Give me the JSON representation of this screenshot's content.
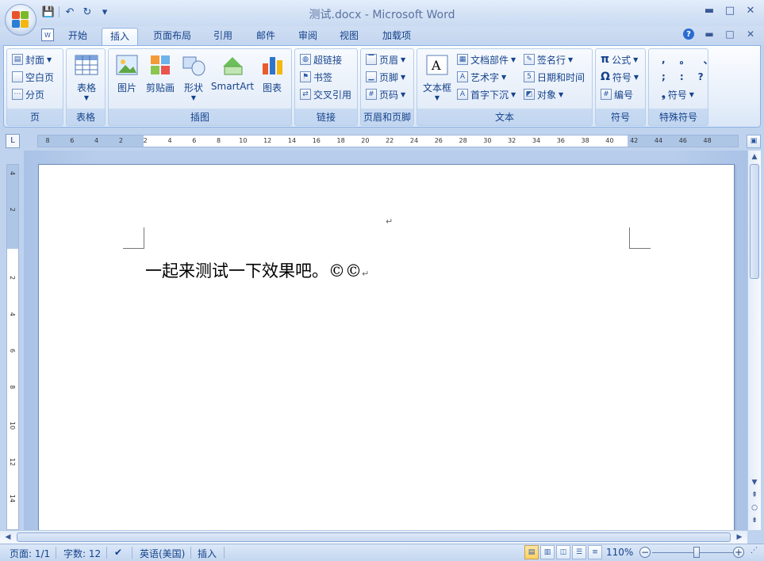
{
  "window": {
    "title": "测试.docx - Microsoft Word",
    "minimize": "▬",
    "maximize": "□",
    "close": "✕"
  },
  "qat": {
    "save": "💾",
    "undo": "↶",
    "redo": "↻",
    "customize": "▾"
  },
  "tabs": [
    {
      "label": "开始"
    },
    {
      "label": "插入"
    },
    {
      "label": "页面布局"
    },
    {
      "label": "引用"
    },
    {
      "label": "邮件"
    },
    {
      "label": "审阅"
    },
    {
      "label": "视图"
    },
    {
      "label": "加载项"
    }
  ],
  "active_tab": "插入",
  "ribbon": {
    "pages": {
      "label": "页",
      "items": [
        "封面",
        "空白页",
        "分页"
      ]
    },
    "tables": {
      "label": "表格",
      "table": "表格"
    },
    "illustrations": {
      "label": "插图",
      "picture": "图片",
      "clipart": "剪贴画",
      "shapes": "形状",
      "smartart": "SmartArt",
      "chart": "图表"
    },
    "links": {
      "label": "链接",
      "items": [
        "超链接",
        "书签",
        "交叉引用"
      ]
    },
    "header_footer": {
      "label": "页眉和页脚",
      "items": [
        "页眉",
        "页脚",
        "页码"
      ]
    },
    "text": {
      "label": "文本",
      "textbox": "文本框",
      "col1": [
        "文档部件",
        "艺术字",
        "首字下沉"
      ],
      "col2": [
        "签名行",
        "日期和时间",
        "对象"
      ]
    },
    "symbols": {
      "label": "符号",
      "items": [
        "公式",
        "符号",
        "编号"
      ],
      "glyphs": [
        "π",
        "Ω",
        "#"
      ]
    },
    "special": {
      "label": "特殊符号",
      "row1": [
        ",",
        "。",
        "、"
      ],
      "row2": [
        ";",
        ":",
        "?"
      ],
      "symbol": "符号",
      "bullet": "❟"
    }
  },
  "ruler": {
    "corner": "L",
    "labels": [
      "8",
      "6",
      "4",
      "2",
      "2",
      "4",
      "6",
      "8",
      "10",
      "12",
      "14",
      "16",
      "18",
      "20",
      "22",
      "24",
      "26",
      "28",
      "30",
      "32",
      "34",
      "36",
      "38",
      "40",
      "42",
      "44",
      "46",
      "48"
    ],
    "vlabels": [
      "4",
      "2",
      "2",
      "4",
      "6",
      "8",
      "10",
      "12",
      "14"
    ]
  },
  "document": {
    "text": "一起来测试一下效果吧。©©",
    "para_mark": "↵"
  },
  "status": {
    "page": "页面: 1/1",
    "words": "字数: 12",
    "language": "英语(美国)",
    "mode": "插入",
    "zoom": "110%",
    "zoom_level": 0.58
  },
  "colors": {
    "accent": "#15428b",
    "ribbon_border": "#8db2e3",
    "page_bg": "#ffffff"
  }
}
